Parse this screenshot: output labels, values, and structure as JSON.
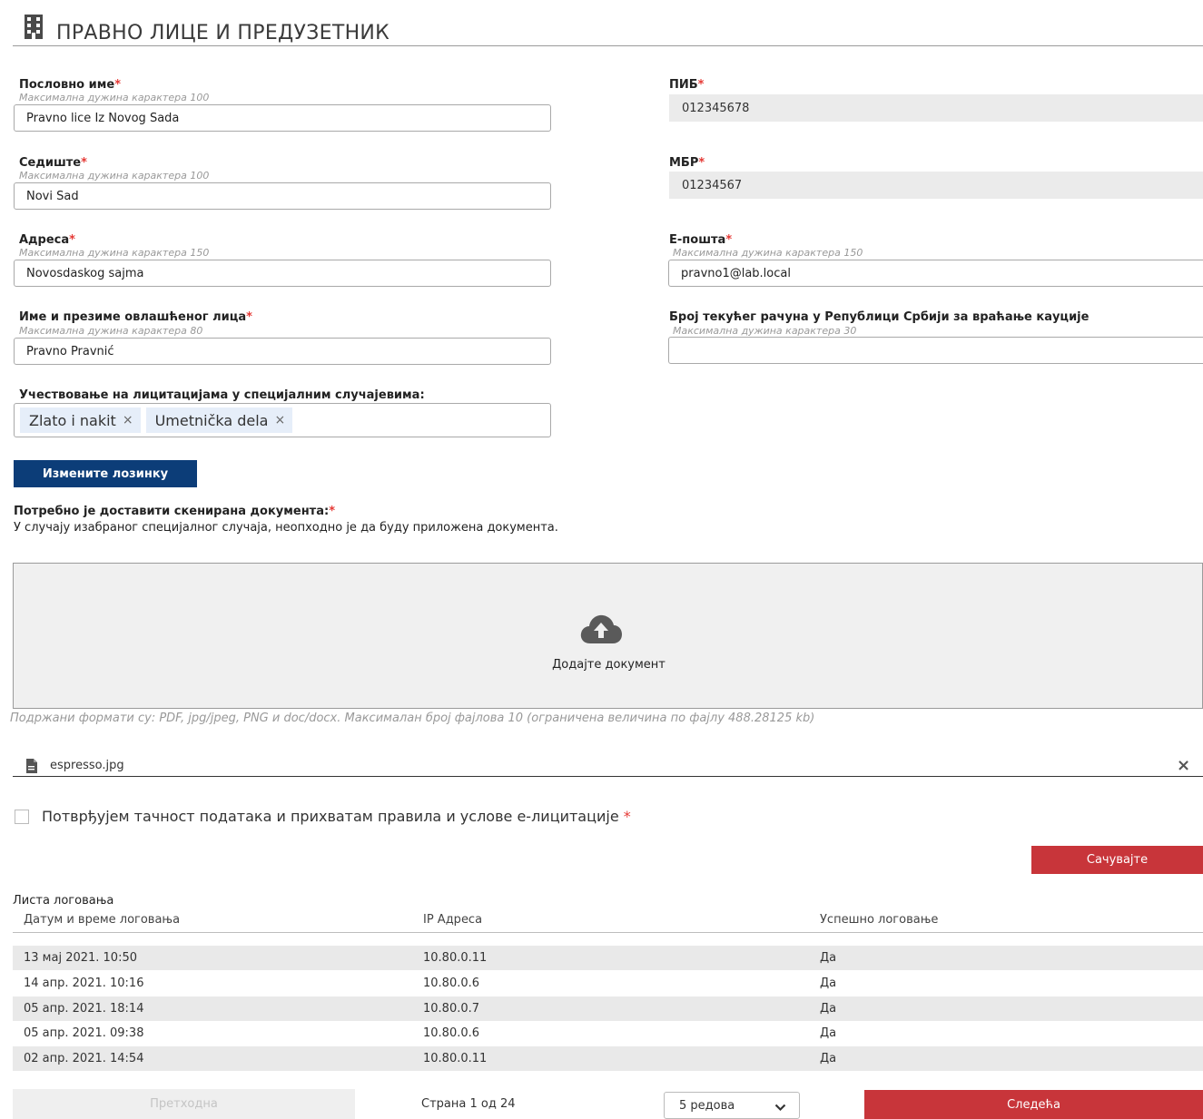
{
  "header": {
    "title": "ПРАВНО ЛИЦЕ И ПРЕДУЗЕТНИК",
    "icon": "building-icon"
  },
  "fields": {
    "business_name": {
      "label": "Пословно име",
      "hint": "Максимална дужина карактера 100",
      "value": "Pravno lice Iz Novog Sada"
    },
    "seat": {
      "label": "Седиште",
      "hint": "Максимална дужина карактера 100",
      "value": "Novi Sad"
    },
    "address": {
      "label": "Адреса",
      "hint": "Максимална дужина карактера 150",
      "value": "Novosdaskog sajma"
    },
    "authorized_person": {
      "label": "Име и презиме овлашћеног лица",
      "hint": "Максимална дужина карактера 80",
      "value": "Pravno Pravnić"
    },
    "pib": {
      "label": "ПИБ",
      "value": "012345678"
    },
    "mbr": {
      "label": "МБР",
      "value": "01234567"
    },
    "email": {
      "label": "Е-пошта",
      "hint": "Максимална дужина карактера 150",
      "value": "pravno1@lab.local"
    },
    "bank_account": {
      "label": "Број текућег рачуна у Републици Србији за враћање кауције",
      "hint": "Максимална дужина карактера 30",
      "value": ""
    },
    "special_cases": {
      "label": "Учествовање на лицитацијама у специјалним случајевима:",
      "tags": [
        "Zlato i nakit",
        "Umetnička dela"
      ]
    }
  },
  "required_mark": "*",
  "chip_remove": "×",
  "change_password_button": "Измените лозинку",
  "documents": {
    "title": "Потребно је доставити скенирана документа:",
    "description": "У случају изабраног специјалног случаја, неопходно је да буду приложена документа.",
    "upload_label": "Додајте документ",
    "upload_icon": "cloud-upload-icon",
    "formats_note": "Подржани формати су: PDF, jpg/jpeg, PNG и doc/docx. Максималан број фајлова 10 (ограничена величина по фајлу 488.28125 kb)",
    "file_name": "espresso.jpg",
    "file_icon": "file-icon",
    "remove": "×"
  },
  "consent": {
    "label": "Потврђујем тачност података и прихватам правила и услове е-лицитације",
    "checked": false
  },
  "save_button": "Сачувајте",
  "login_list": {
    "title": "Листа логовања",
    "columns": [
      "Датум и време логовања",
      "IP Адреса",
      "Успешно логовање"
    ],
    "rows": [
      [
        "13 мај 2021. 10:50",
        "10.80.0.11",
        "Да"
      ],
      [
        "14 апр. 2021. 10:16",
        "10.80.0.6",
        "Да"
      ],
      [
        "05 апр. 2021. 18:14",
        "10.80.0.7",
        "Да"
      ],
      [
        "05 апр. 2021. 09:38",
        "10.80.0.6",
        "Да"
      ],
      [
        "02 апр. 2021. 14:54",
        "10.80.0.11",
        "Да"
      ]
    ]
  },
  "pagination": {
    "previous": "Претходна",
    "page_info": "Страна 1 од 24",
    "rows_per_page": "5 редова",
    "next": "Следећа"
  },
  "colors": {
    "primary_blue": "#0c3d78",
    "danger_red": "#c8353a",
    "required": "#e53935"
  }
}
